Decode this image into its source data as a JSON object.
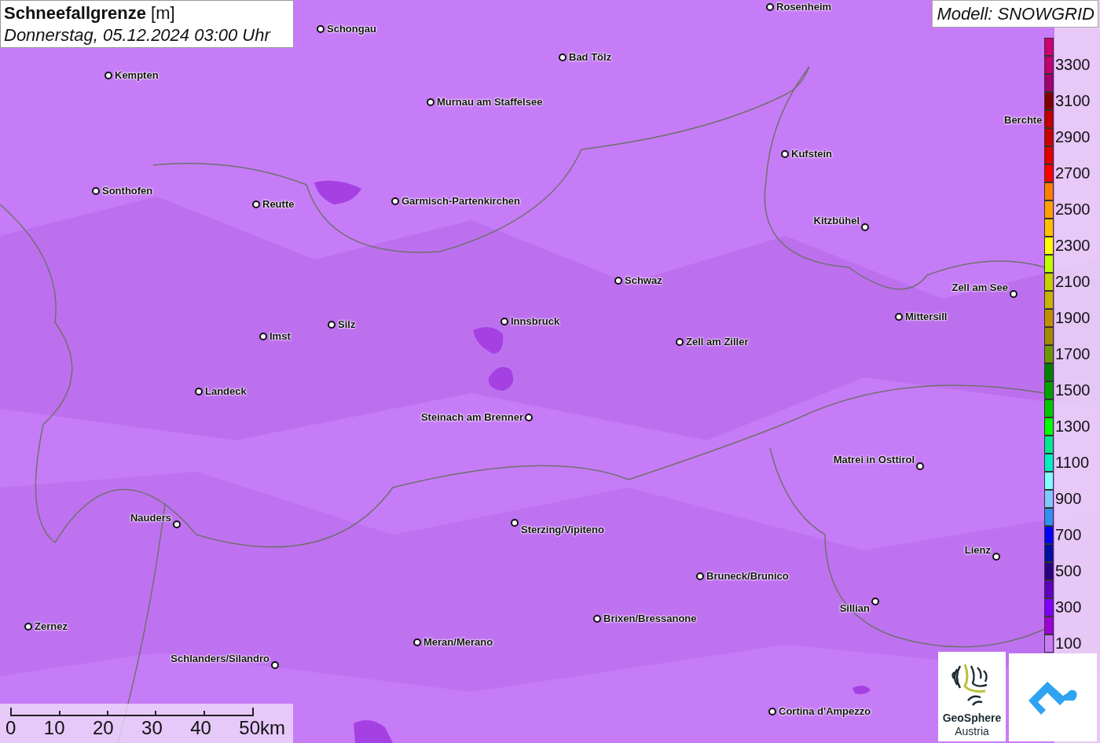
{
  "title": {
    "name": "Schneefallgrenze",
    "unit": "[m]",
    "datetime": "Donnerstag, 05.12.2024 03:00 Uhr"
  },
  "model": "Modell: SNOWGRID",
  "cities": [
    {
      "name": "Rosenheim"
    },
    {
      "name": "Schongau"
    },
    {
      "name": "Bad Tölz"
    },
    {
      "name": "Kempten"
    },
    {
      "name": "Murnau am Staffelsee"
    },
    {
      "name": "Berchte"
    },
    {
      "name": "Kufstein"
    },
    {
      "name": "Sonthofen"
    },
    {
      "name": "Reutte"
    },
    {
      "name": "Garmisch-Partenkirchen"
    },
    {
      "name": "Kitzbühel"
    },
    {
      "name": "Schwaz"
    },
    {
      "name": "Zell am See"
    },
    {
      "name": "Mittersill"
    },
    {
      "name": "Innsbruck"
    },
    {
      "name": "Silz"
    },
    {
      "name": "Imst"
    },
    {
      "name": "Zell am Ziller"
    },
    {
      "name": "Landeck"
    },
    {
      "name": "Steinach am Brenner"
    },
    {
      "name": "Matrei in Osttirol"
    },
    {
      "name": "Nauders"
    },
    {
      "name": "Sterzing/Vipiteno"
    },
    {
      "name": "Lienz"
    },
    {
      "name": "Bruneck/Brunico"
    },
    {
      "name": "Sillian"
    },
    {
      "name": "Brixen/Bressanone"
    },
    {
      "name": "Zernez"
    },
    {
      "name": "Meran/Merano"
    },
    {
      "name": "Schlanders/Silandro"
    },
    {
      "name": "Cortina d'Ampezzo"
    }
  ],
  "legend": {
    "swatches": [
      {
        "color": "#d00070"
      },
      {
        "color": "#c00070",
        "label": "3300"
      },
      {
        "color": "#a00070"
      },
      {
        "color": "#800000",
        "label": "3100"
      },
      {
        "color": "#c00000"
      },
      {
        "color": "#c80000",
        "label": "2900"
      },
      {
        "color": "#e00000"
      },
      {
        "color": "#ff0000",
        "label": "2700"
      },
      {
        "color": "#ff8000"
      },
      {
        "color": "#ffa000",
        "label": "2500"
      },
      {
        "color": "#ffc000"
      },
      {
        "color": "#ffff00",
        "label": "2300"
      },
      {
        "color": "#c0ff00"
      },
      {
        "color": "#c8d000",
        "label": "2100"
      },
      {
        "color": "#c8b400"
      },
      {
        "color": "#c09000",
        "label": "1900"
      },
      {
        "color": "#a08c00"
      },
      {
        "color": "#6e9600",
        "label": "1700"
      },
      {
        "color": "#008000"
      },
      {
        "color": "#00a000",
        "label": "1500"
      },
      {
        "color": "#00c800"
      },
      {
        "color": "#00ff00",
        "label": "1300"
      },
      {
        "color": "#00e890"
      },
      {
        "color": "#00f0c0",
        "label": "1100"
      },
      {
        "color": "#80ffff"
      },
      {
        "color": "#80c8ff",
        "label": "900"
      },
      {
        "color": "#3090f0"
      },
      {
        "color": "#0000ff",
        "label": "700"
      },
      {
        "color": "#0010a0"
      },
      {
        "color": "#2c0080",
        "label": "500"
      },
      {
        "color": "#6000c0"
      },
      {
        "color": "#8000ff",
        "label": "300"
      },
      {
        "color": "#a000d8"
      },
      {
        "color": "#c87cf5",
        "label": "100"
      }
    ]
  },
  "scale_bar": {
    "labels": [
      "0",
      "10",
      "20",
      "30",
      "40",
      "50km"
    ]
  },
  "logos": {
    "geosphere": {
      "line1": "GeoSphere",
      "line2": "Austria"
    }
  }
}
